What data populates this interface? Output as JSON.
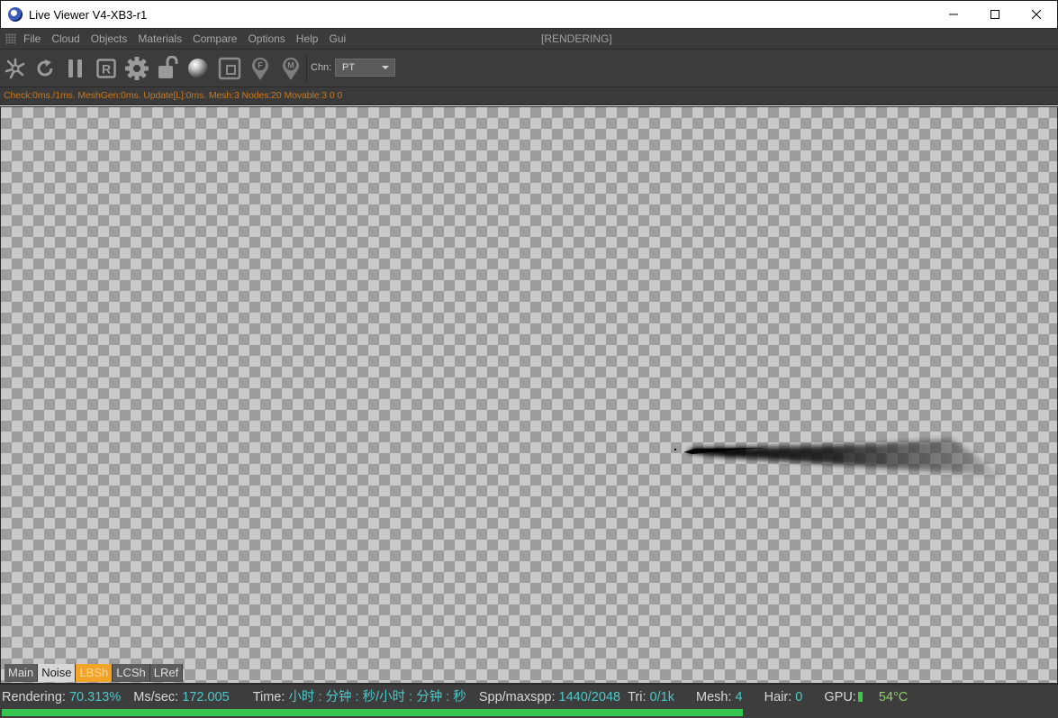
{
  "window": {
    "title": "Live Viewer V4-XB3-r1",
    "app_icon": "cinema4d-icon"
  },
  "menu": {
    "items": [
      "File",
      "Cloud",
      "Objects",
      "Materials",
      "Compare",
      "Options",
      "Help",
      "Gui"
    ],
    "render_state": "[RENDERING]"
  },
  "toolbar": {
    "icons": [
      "send-scene-icon",
      "reload-icon",
      "pause-icon",
      "region-render-icon",
      "settings-gear-icon",
      "lock-icon",
      "material-ball-icon",
      "clay-mode-icon",
      "focus-pick-icon",
      "material-pick-icon"
    ],
    "channel_label": "Chn:",
    "channel_value": "PT"
  },
  "stats": {
    "text": "Check:0ms./1ms. MeshGen:0ms. Update[L]:0ms. Mesh:3 Nodes:20 Movable:3  0 0"
  },
  "tabs": [
    {
      "label": "Main",
      "active": false
    },
    {
      "label": "Noise",
      "active": false
    },
    {
      "label": "LBSh",
      "active": true
    },
    {
      "label": "LCSh",
      "active": false
    },
    {
      "label": "LRef",
      "active": false
    }
  ],
  "status": {
    "rendering_label": "Rendering:",
    "rendering_value": "70.313%",
    "mssec_label": "Ms/sec:",
    "mssec_value": "172.005",
    "time_label": "Time:",
    "time_value": "小时 : 分钟 : 秒/小时 : 分钟 : 秒",
    "spp_label": "Spp/maxspp:",
    "spp_value": "1440/2048",
    "tri_label": "Tri:",
    "tri_value": "0/1k",
    "mesh_label": "Mesh:",
    "mesh_value": "4",
    "hair_label": "Hair:",
    "hair_value": "0",
    "gpu_label": "GPU:",
    "gpu_temp": "54°C",
    "progress": 0.70313
  },
  "colors": {
    "accent_tab": "#f3a326",
    "value_text": "#4dc8c8",
    "progress": "#37c551",
    "stats_text": "#c8781a"
  }
}
